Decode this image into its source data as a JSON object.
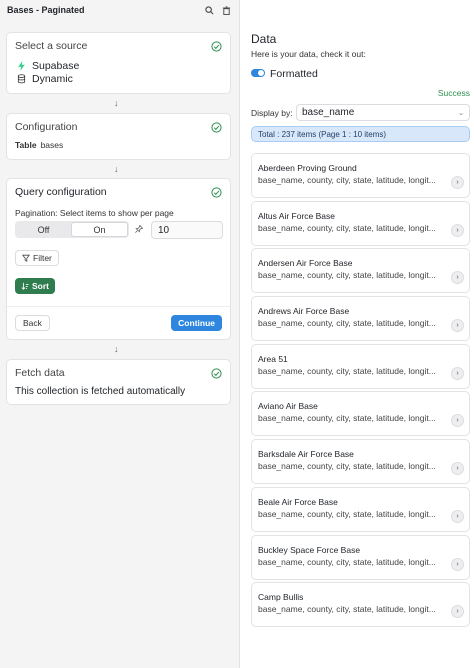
{
  "left": {
    "title": "Bases - Paginated",
    "source_card": {
      "title": "Select a source",
      "items": [
        {
          "label": "Supabase",
          "icon": "bolt-icon"
        },
        {
          "label": "Dynamic",
          "icon": "database-icon"
        }
      ]
    },
    "config_card": {
      "title": "Configuration",
      "key": "Table",
      "value": "bases"
    },
    "query_card": {
      "title": "Query configuration",
      "pagination_label": "Pagination: Select items to show per page",
      "off_label": "Off",
      "on_label": "On",
      "page_size": "10",
      "filter_label": "Filter",
      "sort_label": "Sort",
      "back_label": "Back",
      "continue_label": "Continue"
    },
    "fetch_card": {
      "title": "Fetch data",
      "text": "This collection is fetched automatically"
    }
  },
  "right": {
    "title": "Data",
    "subtitle": "Here is your data, check it out:",
    "format_label": "Formatted",
    "status": "Success",
    "display_by_label": "Display by:",
    "display_by_value": "base_name",
    "total_text": "Total : 237 items (Page 1 : 10 items)",
    "fields_text": "base_name, county, city, state, latitude, longit...",
    "items": [
      "Aberdeen Proving Ground",
      "Altus Air Force Base",
      "Andersen Air Force Base",
      "Andrews Air Force Base",
      "Area 51",
      "Aviano Air Base",
      "Barksdale Air Force Base",
      "Beale Air Force Base",
      "Buckley Space Force Base",
      "Camp Bullis"
    ]
  },
  "colors": {
    "accent": "#2e86de",
    "success": "#2f8f4f",
    "sort_button": "#2f7d4f",
    "total_bg": "#d8e8fa"
  }
}
